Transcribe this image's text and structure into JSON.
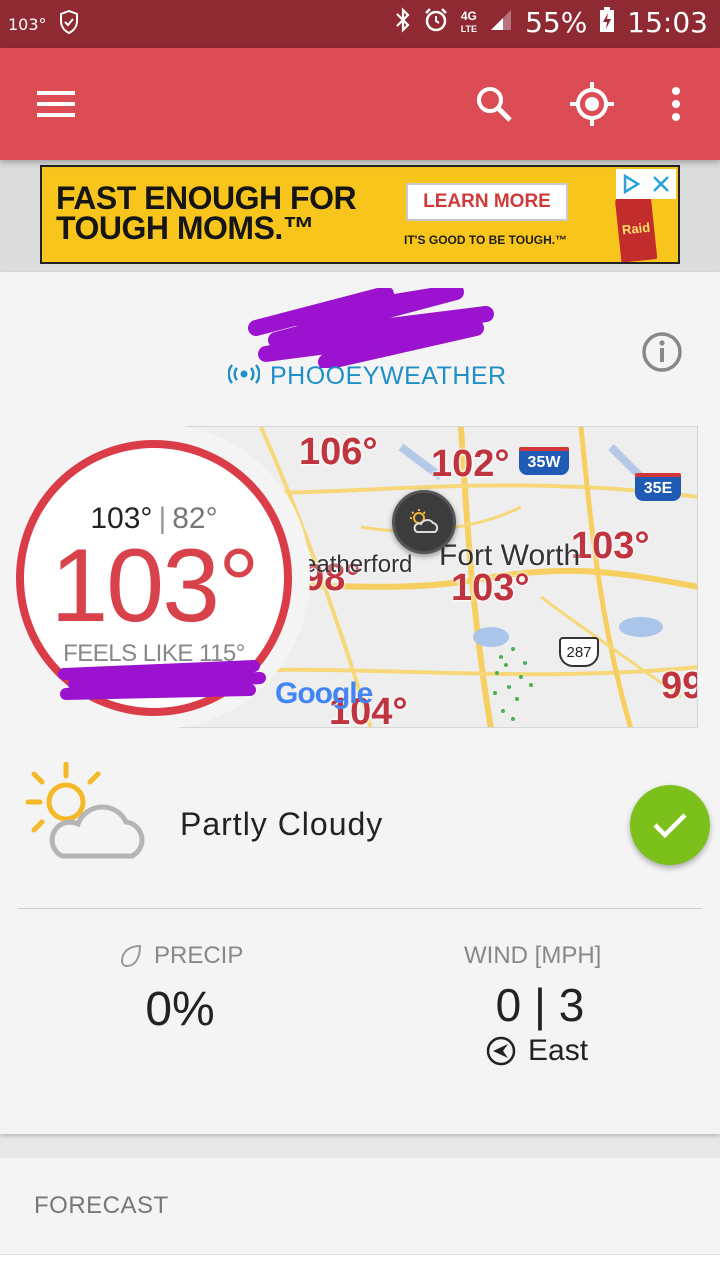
{
  "status_bar": {
    "temp": "103°",
    "battery": "55%",
    "time": "15:03",
    "network": "4G"
  },
  "toolbar": {
    "icons": [
      "menu-icon",
      "search-icon",
      "locate-icon",
      "more-vert-icon"
    ]
  },
  "ad": {
    "headline_1": "FAST ENOUGH FOR",
    "headline_2": "TOUGH MOMS.™",
    "cta": "LEARN MORE",
    "tagline": "IT'S GOOD TO BE TOUGH.™",
    "product": "Raid"
  },
  "station": {
    "name": "PHOOEYWEATHER"
  },
  "current": {
    "high": "103°",
    "low": "82°",
    "temp": "103°",
    "feels_like": "FEELS LIKE 115°",
    "condition": "Partly Cloudy"
  },
  "map": {
    "labels": [
      "106°",
      "102°",
      "98°",
      "103°",
      "103°",
      "104°",
      "99"
    ],
    "city_1": "Fort Worth",
    "city_2": "eatherford",
    "shields": [
      "35W",
      "35E",
      "287"
    ],
    "attribution": "Google"
  },
  "precip": {
    "label": "PRECIP",
    "value": "0%"
  },
  "wind": {
    "label": "WIND [MPH]",
    "value": "0 | 3",
    "direction": "East"
  },
  "forecast": {
    "label": "FORECAST"
  },
  "colors": {
    "status_bar": "#8f2a33",
    "toolbar": "#db4c55",
    "accent_red": "#da3d47",
    "station_blue": "#1f8fc8",
    "check_green": "#7cc11b"
  }
}
